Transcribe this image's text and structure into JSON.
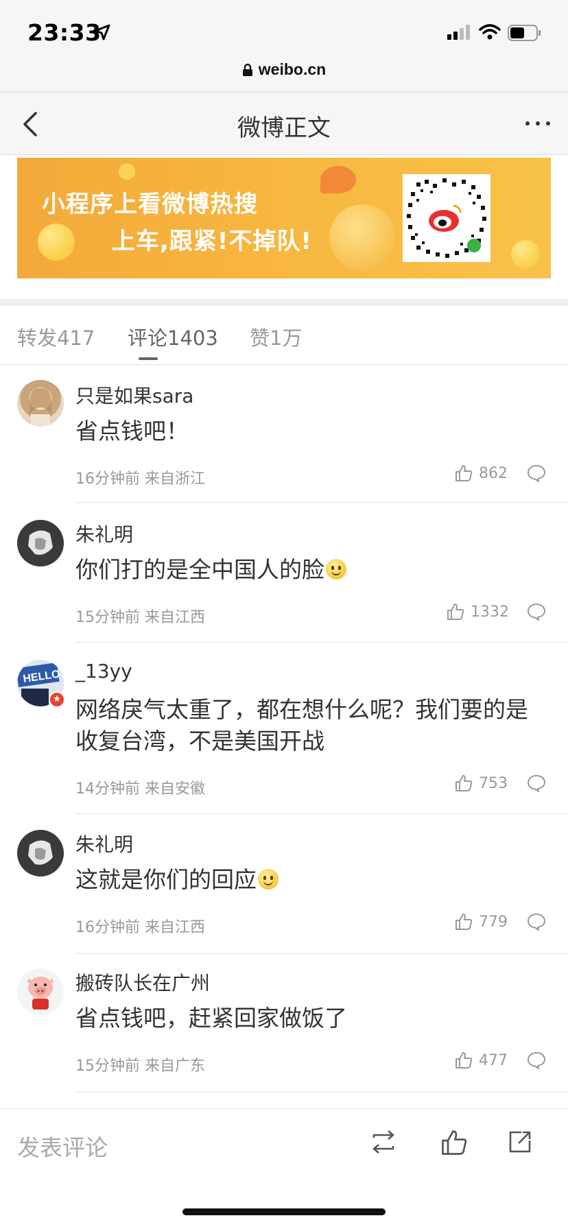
{
  "status_bar": {
    "time": "23:33"
  },
  "url_bar": {
    "url": "weibo.cn"
  },
  "nav": {
    "title": "微博正文"
  },
  "banner": {
    "line1": "小程序上看微博热搜",
    "line2": "上车,跟紧!不掉队!"
  },
  "tabs": [
    {
      "label": "转发417",
      "active": false
    },
    {
      "label": "评论1403",
      "active": true
    },
    {
      "label": "赞1万",
      "active": false
    }
  ],
  "comments": [
    {
      "name": "只是如果sara",
      "text": "省点钱吧！",
      "meta": "16分钟前 来自浙江",
      "likes": "862",
      "emoji": false
    },
    {
      "name": "朱礼明",
      "text": "你们打的是全中国人的脸",
      "meta": "15分钟前 来自江西",
      "likes": "1332",
      "emoji": true
    },
    {
      "name": "_13yy",
      "text": "网络戾气太重了，都在想什么呢？我们要的是收复台湾，不是美国开战",
      "meta": "14分钟前 来自安徽",
      "likes": "753",
      "emoji": false
    },
    {
      "name": "朱礼明",
      "text": "这就是你们的回应",
      "meta": "16分钟前 来自江西",
      "likes": "779",
      "emoji": true
    },
    {
      "name": "搬砖队长在广州",
      "text": "省点钱吧，赶紧回家做饭了",
      "meta": "15分钟前 来自广东",
      "likes": "477",
      "emoji": false
    }
  ],
  "bottom_bar": {
    "compose_placeholder": "发表评论"
  },
  "icons": {
    "status": [
      "location-arrow-icon",
      "signal-icon",
      "wifi-icon",
      "battery-icon"
    ],
    "nav": [
      "back-icon",
      "more-icon"
    ],
    "comment": [
      "like-icon",
      "reply-icon"
    ],
    "bottom": [
      "repost-icon",
      "like-icon",
      "share-icon"
    ]
  },
  "colors": {
    "banner": "#f7b63f",
    "text": "#333333",
    "muted": "#999999"
  }
}
